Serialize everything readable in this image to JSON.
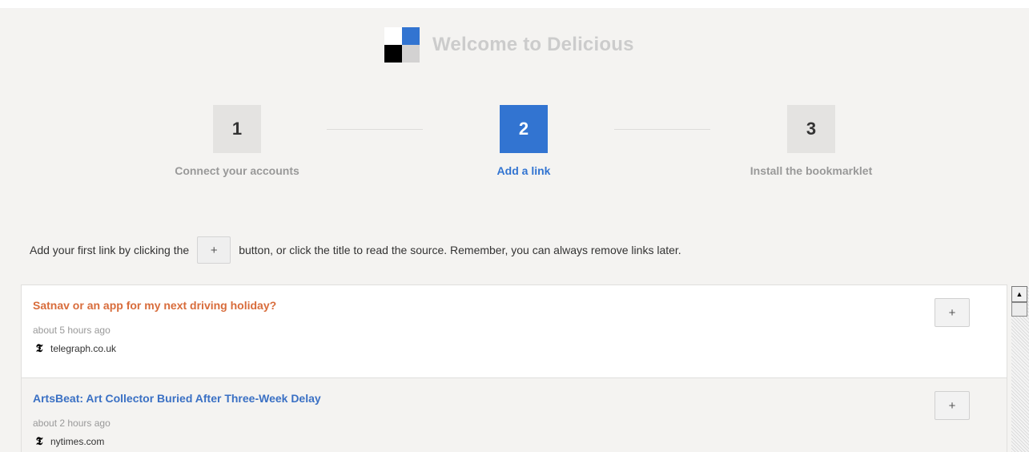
{
  "header": {
    "title": "Welcome to Delicious",
    "logo_colors": [
      "#ffffff",
      "#3274d1",
      "#000000",
      "#d3d2d2"
    ]
  },
  "steps": [
    {
      "number": "1",
      "label": "Connect your accounts",
      "state": "inactive"
    },
    {
      "number": "2",
      "label": "Add a link",
      "state": "active"
    },
    {
      "number": "3",
      "label": "Install the bookmarklet",
      "state": "inactive"
    }
  ],
  "instruction": {
    "before": "Add your first link by clicking the",
    "button_label": "+",
    "after": "button, or click the title to read the source. Remember, you can always remove links later."
  },
  "links": [
    {
      "title": "Satnav or an app for my next driving holiday?",
      "time": "about 5 hours ago",
      "source": "telegraph.co.uk",
      "favicon_glyph": "𝕿",
      "add_label": "+"
    },
    {
      "title": "ArtsBeat: Art Collector Buried After Three-Week Delay",
      "time": "about 2 hours ago",
      "source": "nytimes.com",
      "favicon_glyph": "𝕿",
      "add_label": "+"
    }
  ],
  "scrollbar": {
    "up_arrow": "▲"
  },
  "colors": {
    "accent_blue": "#3274d1",
    "highlight_orange": "#d86c3b",
    "muted_text": "#999999"
  }
}
